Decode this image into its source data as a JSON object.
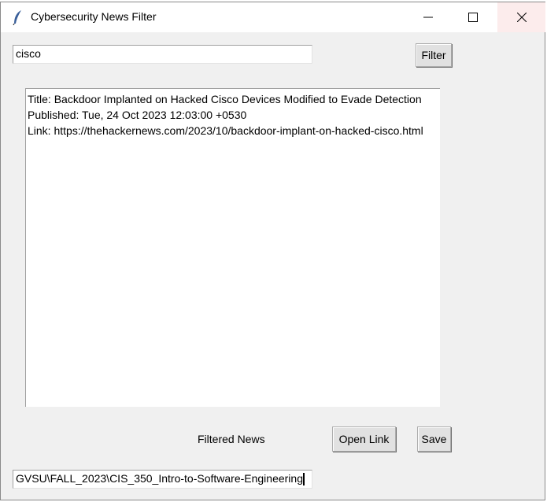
{
  "window": {
    "title": "Cybersecurity News Filter",
    "app_icon": "feather-icon"
  },
  "search": {
    "value": "cisco",
    "button": "Filter"
  },
  "results": [
    "Title: Backdoor Implanted on Hacked Cisco Devices Modified to Evade Detection",
    "Published: Tue, 24 Oct 2023 12:03:00 +0530",
    "Link: https://thehackernews.com/2023/10/backdoor-implant-on-hacked-cisco.html"
  ],
  "footer": {
    "label": "Filtered News",
    "open_link": "Open Link",
    "save": "Save"
  },
  "path": {
    "value": "GVSU\\FALL_2023\\CIS_350_Intro-to-Software-Engineering"
  }
}
